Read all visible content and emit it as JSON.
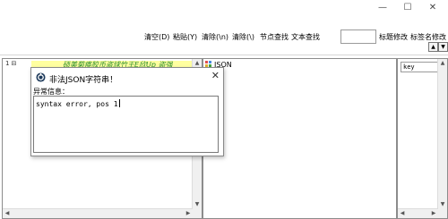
{
  "window": {
    "minimize_glyph": "—",
    "maximize_glyph": "☐",
    "close_glyph": "✕"
  },
  "toolbar": {
    "clear": "清空(D)",
    "paste": "粘贴(Y)",
    "clear_newline": "清除(\\n)",
    "clear_backslash": "清除(\\)",
    "node_search": "节点查找",
    "text_search": "文本查找",
    "search_value": "",
    "tag_modify": "标题修改",
    "tag_name_modify": "标签名修改"
  },
  "editor": {
    "line_number": "1 ⊟",
    "ad_text": "硕美菊痪胶币盗球竹王E欣Up  盗强"
  },
  "tree": {
    "root_label": "JSON"
  },
  "right_panel": {
    "selected": "key"
  },
  "dialog": {
    "title": "非法JSON字符串！",
    "label": "异常信息：",
    "message": "syntax error, pos 1"
  },
  "colors": {
    "accent": "#2d8f2d",
    "highlight": "#ffffa0"
  }
}
